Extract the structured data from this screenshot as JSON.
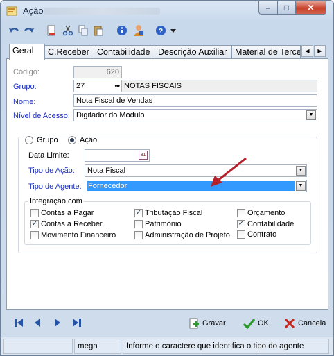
{
  "window": {
    "title": "Ação"
  },
  "toolbar": {
    "icons": [
      "undo-icon",
      "redo-icon",
      "delete-document-icon",
      "cut-icon",
      "copy-icon",
      "paste-icon",
      "info-icon",
      "user-icon",
      "help-icon",
      "dropdown-arrow-icon"
    ]
  },
  "tabs": [
    "Geral",
    "C.Receber",
    "Contabilidade",
    "Descrição Auxiliar",
    "Material de Terceiros"
  ],
  "form": {
    "codigo_label": "Código:",
    "codigo_value": "620",
    "grupo_label": "Grupo:",
    "grupo_code": "27",
    "grupo_lookup": "•••",
    "grupo_name": "NOTAS FISCAIS",
    "nome_label": "Nome:",
    "nome_value": "Nota Fiscal de Vendas",
    "nivel_label": "Nível de Acesso:",
    "nivel_value": "Digitador do Módulo"
  },
  "mode": {
    "grupo_radio": "Grupo",
    "acao_radio": "Ação",
    "selected": "Ação",
    "data_limite_label": "Data Limite:",
    "data_limite_value": "",
    "calendar_glyph": "31",
    "tipo_acao_label": "Tipo de Ação:",
    "tipo_acao_value": "Nota Fiscal",
    "tipo_agente_label": "Tipo de Agente:",
    "tipo_agente_value": "Fornecedor"
  },
  "integracao": {
    "title": "Integração com",
    "items": [
      {
        "label": "Contas a Pagar",
        "checked": false
      },
      {
        "label": "Contas a Receber",
        "checked": true
      },
      {
        "label": "Movimento Financeiro",
        "checked": false
      },
      {
        "label": "Tributação Fiscal",
        "checked": true
      },
      {
        "label": "Patrimônio",
        "checked": false
      },
      {
        "label": "Administração de Projeto",
        "checked": false
      },
      {
        "label": "Orçamento",
        "checked": false
      },
      {
        "label": "Contabilidade",
        "checked": true
      },
      {
        "label": "Contrato",
        "checked": false
      }
    ]
  },
  "actions": {
    "gravar": "Gravar",
    "ok": "OK",
    "cancela": "Cancela"
  },
  "status": {
    "cell1": "",
    "cell2": "mega",
    "cell3": "Informe o caractere que identifica o tipo do agente"
  },
  "colors": {
    "label_blue": "#1c2fc2",
    "selection_blue": "#3399ff",
    "arrow_red": "#b51f2a"
  }
}
